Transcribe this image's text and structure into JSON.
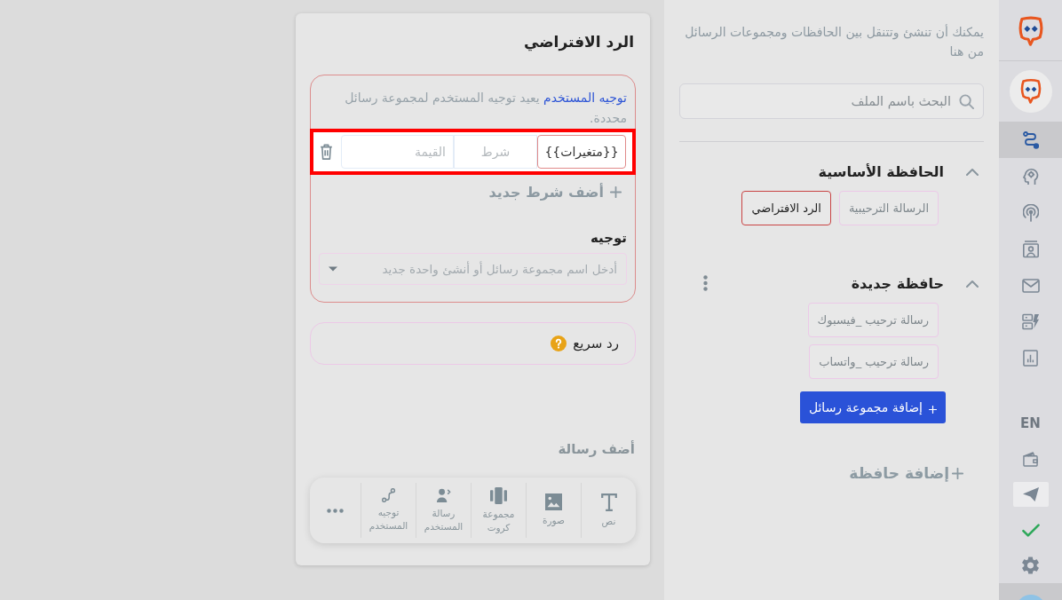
{
  "sidebar": {
    "nav_items": [
      {
        "selected": true
      },
      {
        "selected": false
      },
      {
        "selected": false
      },
      {
        "selected": false
      },
      {
        "selected": false
      },
      {
        "selected": false
      },
      {
        "selected": false
      }
    ],
    "language": "EN",
    "tools": [
      {
        "highlighted": false
      },
      {
        "highlighted": true
      },
      {
        "highlighted": false
      },
      {
        "highlighted": false
      }
    ],
    "profile": {
      "selected": true
    }
  },
  "folders_panel": {
    "description": "يمكنك أن تنشئ وتتنقل بين الحافظات ومجموعات الرسائل من هنا",
    "search": {
      "placeholder": "البحث باسم الملف"
    },
    "folders": [
      {
        "name": "الحافظة الأساسية",
        "expanded": true,
        "show_menu": false,
        "groups": [
          {
            "label": "الرسالة الترحيبية",
            "selected": false
          },
          {
            "label": "الرد الافتراضي",
            "selected": true
          }
        ]
      },
      {
        "name": "حافظة جديدة",
        "expanded": true,
        "show_menu": true,
        "groups": [
          {
            "label": "رسالة ترحيب _فيسبوك",
            "selected": false
          },
          {
            "label": "رسالة ترحيب _واتساب",
            "selected": false
          }
        ],
        "add_group_button": "إضافة مجموعة رسائل"
      }
    ],
    "add_folder": "إضافة حافظة"
  },
  "editor": {
    "title": "الرد الافتراضي",
    "redirect_block": {
      "link": "توجيه المستخدم",
      "description": "يعيد توجيه المستخدم لمجموعة رسائل محددة.",
      "condition": {
        "variable": "{{متغيرات}}",
        "operator_placeholder": "شرط",
        "value_placeholder": "القيمة",
        "highlighted": true
      },
      "add_condition": "أضف شرط جديد",
      "redirect_label": "توجيه",
      "redirect_field": {
        "placeholder": "أدخل اسم مجموعة رسائل أو أنشئ واحدة جديد"
      }
    },
    "quick_reply": {
      "label": "رد سريع"
    },
    "add_message": {
      "title": "أضف رسالة",
      "tools": [
        {
          "label": "نص"
        },
        {
          "label": "صورة"
        },
        {
          "label": "مجموعة كروت"
        },
        {
          "label": "رسالة المستخدم"
        },
        {
          "label": "توجيه المستخدم"
        }
      ]
    }
  }
}
